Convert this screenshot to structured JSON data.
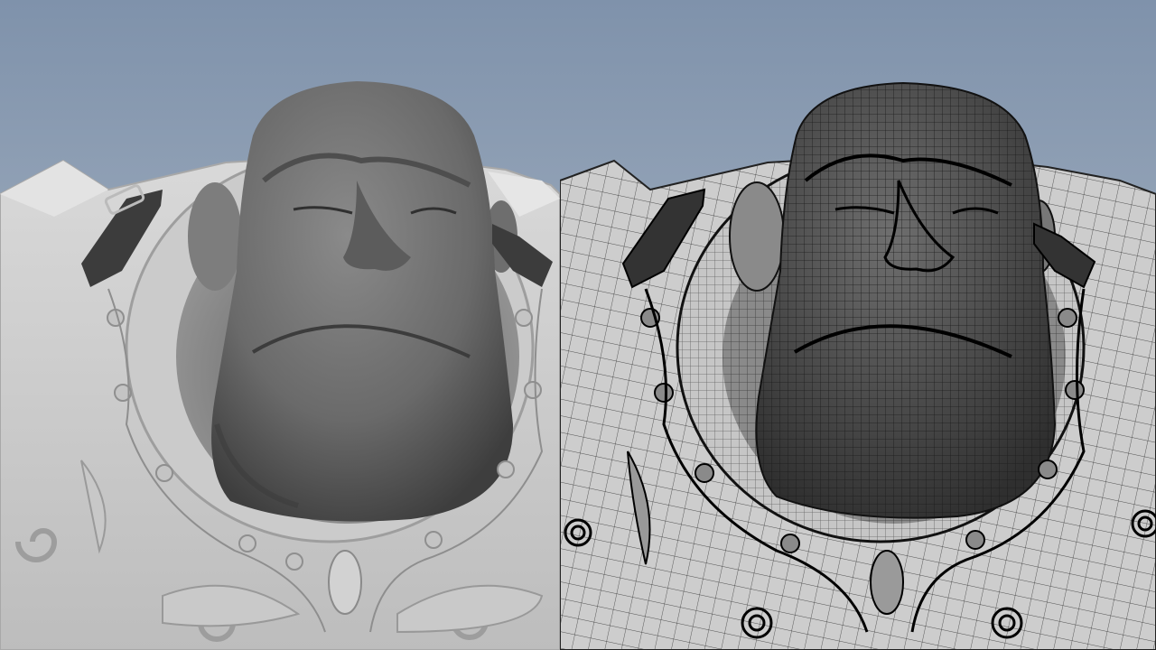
{
  "scene": {
    "views": [
      {
        "id": "shaded",
        "mode": "smooth-shaded"
      },
      {
        "id": "wireframe",
        "mode": "wireframe-on-shaded"
      }
    ],
    "colors": {
      "background_top": "#7f92ab",
      "background_bottom": "#b7c1cc",
      "head": "#6e6e6e",
      "body": "#cfcfcf",
      "strap": "#3c3c3c",
      "wire": "#1e1e1e"
    }
  }
}
